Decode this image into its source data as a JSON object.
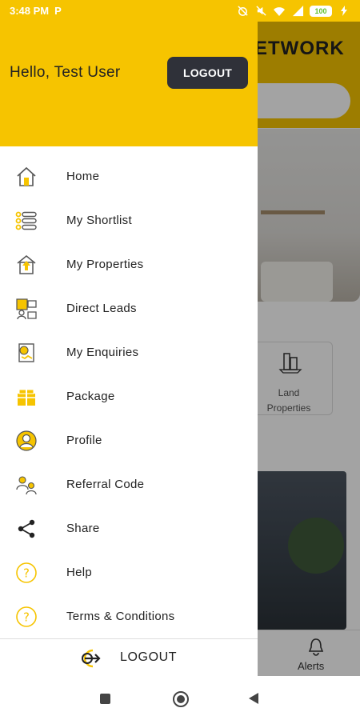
{
  "status_bar": {
    "time": "3:48 PM",
    "notification_icon": "P",
    "battery": "100"
  },
  "background": {
    "brand_fragment": "ETWORK",
    "category_card_label": "Land Properties",
    "bottom_nav_alerts_label": "Alerts"
  },
  "drawer": {
    "greeting": "Hello, Test User",
    "header_logout_label": "LOGOUT",
    "menu": [
      {
        "label": "Home",
        "icon": "home-icon"
      },
      {
        "label": "My Shortlist",
        "icon": "list-icon"
      },
      {
        "label": "My Properties",
        "icon": "properties-icon"
      },
      {
        "label": "Direct Leads",
        "icon": "leads-icon"
      },
      {
        "label": "My Enquiries",
        "icon": "enquiries-icon"
      },
      {
        "label": "Package",
        "icon": "package-icon"
      },
      {
        "label": "Profile",
        "icon": "profile-icon"
      },
      {
        "label": "Referral Code",
        "icon": "referral-icon"
      },
      {
        "label": "Share",
        "icon": "share-icon"
      },
      {
        "label": "Help",
        "icon": "help-icon"
      },
      {
        "label": "Terms & Conditions",
        "icon": "terms-icon"
      }
    ],
    "footer_logout_label": "LOGOUT"
  },
  "colors": {
    "accent": "#f6c400",
    "dark_button": "#2f3139"
  }
}
